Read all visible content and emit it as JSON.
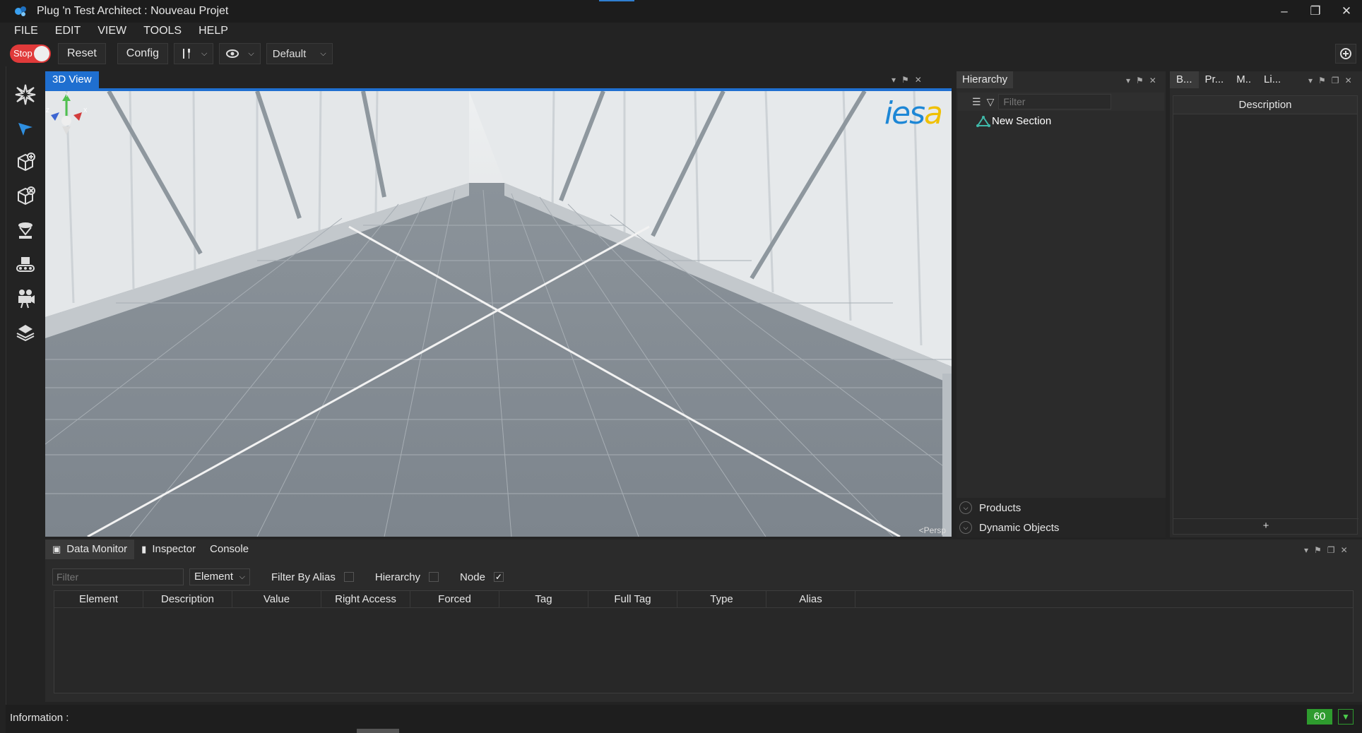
{
  "window": {
    "title": "Plug 'n Test Architect : Nouveau Projet",
    "minimize": "–",
    "restore": "❐",
    "close": "✕"
  },
  "menu": [
    "FILE",
    "EDIT",
    "VIEW",
    "TOOLS",
    "HELP"
  ],
  "toolbar": {
    "stop_label": "Stop",
    "reset_label": "Reset",
    "config_label": "Config",
    "view_select": "Default"
  },
  "lefttools": [
    "explode-icon",
    "select-arrow-icon",
    "add-box-icon",
    "remove-box-icon",
    "sensor-icon",
    "conveyor-icon",
    "camera-icon",
    "robot-icon"
  ],
  "view3d": {
    "tab": "3D View",
    "logo_a": "ies",
    "logo_b": "a",
    "persp": "<Persp",
    "axis_x": "X",
    "axis_y": "Y",
    "axis_z": "Z"
  },
  "hierarchy": {
    "tab": "Hierarchy",
    "filter_placeholder": "Filter",
    "node": "New Section",
    "products": "Products",
    "dynamic_objects": "Dynamic Objects"
  },
  "props": {
    "tabs": [
      "B...",
      "Pr...",
      "M..",
      "Li..."
    ],
    "description": "Description",
    "add": "+"
  },
  "bottom": {
    "tabs": [
      "Data Monitor",
      "Inspector",
      "Console"
    ],
    "filter_placeholder": "Filter",
    "element_select": "Element",
    "filter_by_alias": "Filter By Alias",
    "hierarchy": "Hierarchy",
    "node": "Node",
    "node_checked": "✓",
    "columns": [
      "Element",
      "Description",
      "Value",
      "Right Access",
      "Forced",
      "Tag",
      "Full Tag",
      "Type",
      "Alias"
    ]
  },
  "status": {
    "info": "Information :",
    "fps": "60"
  }
}
